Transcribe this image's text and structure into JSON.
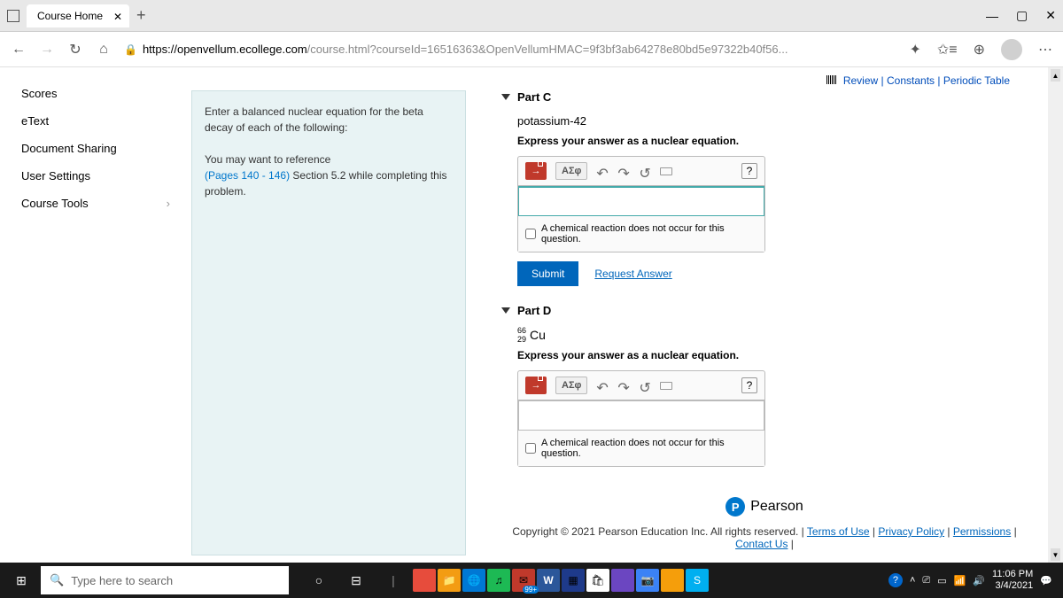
{
  "browser": {
    "tab_title": "Course Home",
    "url_host": "https://openvellum.ecollege.com",
    "url_path": "/course.html?courseId=16516363&OpenVellumHMAC=9f3bf3ab64278e80bd5e97322b40f56..."
  },
  "top_links": {
    "review": "Review",
    "constants": "Constants",
    "periodic": "Periodic Table"
  },
  "sidebar": {
    "items": [
      "Scores",
      "eText",
      "Document Sharing",
      "User Settings",
      "Course Tools"
    ]
  },
  "instruction": {
    "line1": "Enter a balanced nuclear equation for the beta decay of each of the following:",
    "line2a": "You may want to reference",
    "line2b": "(Pages 140 - 146)",
    "line2c": " Section 5.2 while completing this problem."
  },
  "partC": {
    "header": "Part C",
    "subject": "potassium-42",
    "instr": "Express your answer as a nuclear equation.",
    "greek": "ΑΣφ",
    "checkbox": "A chemical reaction does not occur for this question.",
    "submit": "Submit",
    "request": "Request Answer"
  },
  "partD": {
    "header": "Part D",
    "mass": "66",
    "atomic": "29",
    "symbol": "Cu",
    "instr": "Express your answer as a nuclear equation.",
    "greek": "ΑΣφ",
    "checkbox": "A chemical reaction does not occur for this question."
  },
  "footer": {
    "pearson": "Pearson",
    "copyright": "Copyright © 2021 Pearson Education Inc. All rights reserved. | ",
    "terms": "Terms of Use",
    "privacy": "Privacy Policy",
    "permissions": "Permissions",
    "contact": "Contact Us"
  },
  "taskbar": {
    "search_placeholder": "Type here to search",
    "badge": "99+",
    "time": "11:06 PM",
    "date": "3/4/2021"
  }
}
